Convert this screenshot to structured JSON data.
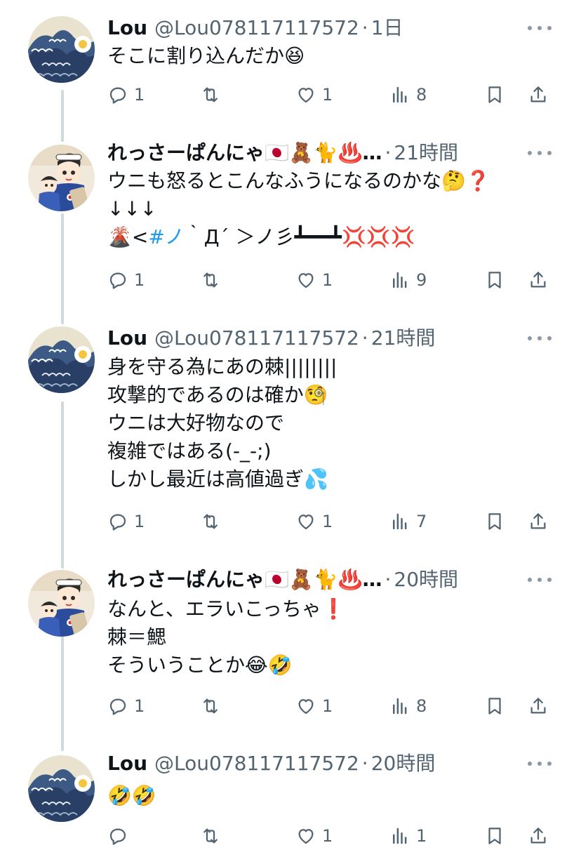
{
  "tweets": [
    {
      "name": "Lou",
      "handle": "@Lou078117117572",
      "sep": "·",
      "time": "1日",
      "lines": [
        "そこに割り込んだか😆"
      ],
      "reply_count": "1",
      "like_count": "1",
      "view_count": "8",
      "avatar": "wave"
    },
    {
      "name": "れっさーぱんにゃ🇯🇵🧸🐈♨️…",
      "handle": "",
      "sep": "·",
      "time": "21時間",
      "lines": [
        "ウニも怒るとこんなふうになるのかな🤔❓",
        "↓↓↓"
      ],
      "line3_prefix": "🌋<",
      "line3_hashtag": "#ノ",
      "line3_suffix": "｀Д´ ＞ノ彡┻━━┻💢💢💢",
      "reply_count": "1",
      "like_count": "1",
      "view_count": "9",
      "avatar": "anime"
    },
    {
      "name": "Lou",
      "handle": "@Lou078117117572",
      "sep": "·",
      "time": "21時間",
      "lines": [
        "身を守る為にあの棘||||||||",
        "攻撃的であるのは確か🧐",
        "ウニは大好物なので",
        "複雑ではある(-_-;)",
        "しかし最近は高値過ぎ💦"
      ],
      "reply_count": "1",
      "like_count": "1",
      "view_count": "7",
      "avatar": "wave"
    },
    {
      "name": "れっさーぱんにゃ🇯🇵🧸🐈♨️…",
      "handle": "",
      "sep": "·",
      "time": "20時間",
      "lines": [
        "なんと、エラいこっちゃ❗️",
        "棘＝鰓",
        "そういうことか😂🤣"
      ],
      "reply_count": "1",
      "like_count": "1",
      "view_count": "8",
      "avatar": "anime"
    },
    {
      "name": "Lou",
      "handle": "@Lou078117117572",
      "sep": "·",
      "time": "20時間",
      "lines": [
        "🤣🤣"
      ],
      "reply_count": "",
      "like_count": "1",
      "view_count": "1",
      "avatar": "wave"
    }
  ],
  "icons": {
    "reply": "reply-icon",
    "retweet": "retweet-icon",
    "like": "like-icon",
    "views": "views-icon",
    "bookmark": "bookmark-icon",
    "share": "share-icon",
    "more": "more-icon"
  },
  "colors": {
    "text": "#0f1419",
    "secondary": "#536471",
    "hashtag": "#1d9bf0",
    "thread_line": "#cfd9de"
  }
}
